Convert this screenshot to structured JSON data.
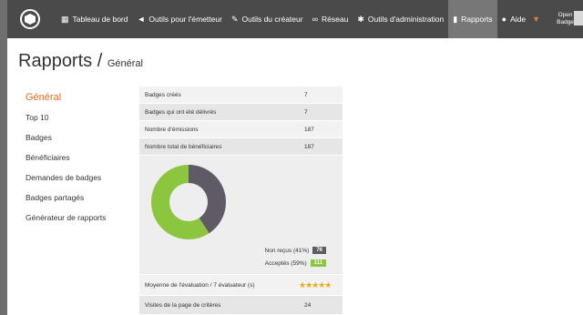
{
  "nav": {
    "items": [
      {
        "icon": "grid-icon",
        "glyph": "▦",
        "label": "Tableau de bord"
      },
      {
        "icon": "send-icon",
        "glyph": "◄",
        "label": "Outils pour l'émetteur"
      },
      {
        "icon": "wrench-icon",
        "glyph": "✎",
        "label": "Outils du créateur"
      },
      {
        "icon": "link-icon",
        "glyph": "∞",
        "label": "Réseau"
      },
      {
        "icon": "gear-icon",
        "glyph": "✱",
        "label": "Outils d'administration"
      },
      {
        "icon": "bar-chart-icon",
        "glyph": "▮",
        "label": "Rapports"
      },
      {
        "icon": "help-icon",
        "glyph": "●",
        "label": "Aide"
      }
    ],
    "open_badge": "Open Badge"
  },
  "page": {
    "title": "Rapports",
    "separator": " / ",
    "subtitle": "Général"
  },
  "sidebar": {
    "items": [
      "Général",
      "Top 10",
      "Badges",
      "Bénéficiaires",
      "Demandes de badges",
      "Badges partagés",
      "Générateur de rapports"
    ]
  },
  "stats": {
    "rows": [
      {
        "label": "Badges créés",
        "value": "7"
      },
      {
        "label": "Badges qui ont été délivrés",
        "value": "7"
      },
      {
        "label": "Nombre d'émissions",
        "value": "187"
      },
      {
        "label": "Nombre total de bénéficiaires",
        "value": "187"
      }
    ],
    "legend": {
      "not_received": {
        "label": "Non reçus (41%)",
        "value": "76",
        "color": "#5f5a66"
      },
      "accepted": {
        "label": "Acceptés (59%)",
        "value": "111",
        "color": "#8cc63f"
      }
    },
    "rating": {
      "label": "Moyenne de l'évaluation / 7 évaluateur (s)",
      "stars": 5,
      "glyphs": "★★★★★"
    },
    "visits": {
      "label": "Visites de la page de critères",
      "value": "24"
    }
  },
  "chart_data": {
    "type": "pie",
    "categories": [
      "Non reçus",
      "Acceptés"
    ],
    "values": [
      76,
      111
    ],
    "colors": [
      "#5f5a66",
      "#8cc63f"
    ]
  }
}
